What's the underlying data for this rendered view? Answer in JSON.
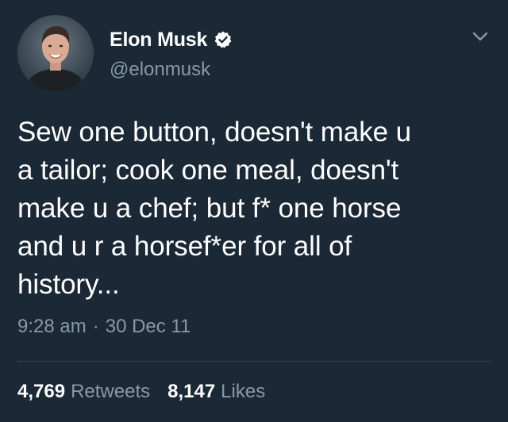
{
  "author": {
    "display_name": "Elon Musk",
    "handle": "@elonmusk",
    "verified": true,
    "verified_icon": "verified-badge-icon",
    "avatar_icon": "profile-avatar"
  },
  "menu": {
    "icon": "chevron-down-icon"
  },
  "tweet": {
    "text_lines": [
      "Sew one button, doesn't make u",
      "a tailor; cook one meal, doesn't",
      "make u a chef; but f* one horse",
      "and u r a horsef*er for all of",
      "history..."
    ],
    "time": "9:28 am",
    "separator": "·",
    "date": "30 Dec 11"
  },
  "stats": {
    "retweets_count": "4,769",
    "retweets_label": "Retweets",
    "likes_count": "8,147",
    "likes_label": "Likes"
  },
  "colors": {
    "background": "#1b2836",
    "primary_text": "#ffffff",
    "secondary_text": "#8899a6",
    "divider": "#38444d"
  }
}
